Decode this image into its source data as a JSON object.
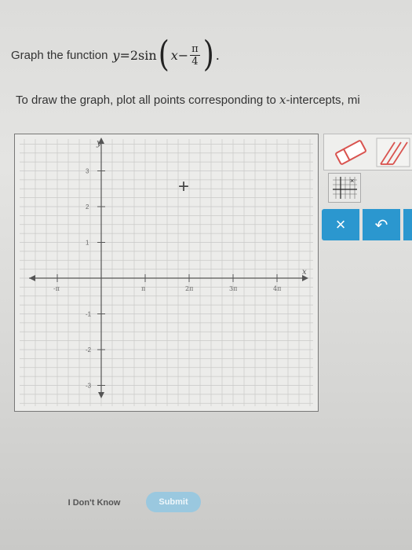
{
  "question": {
    "prefix": "Graph the function",
    "func_y": "y",
    "func_eq": "=2sin",
    "func_x": "x",
    "func_minus": "−",
    "frac_num": "π",
    "frac_den": "4",
    "suffix": "."
  },
  "instruction": {
    "part1": "To draw the graph, plot all points corresponding to ",
    "var": "x",
    "part2": "-intercepts, mi"
  },
  "graph": {
    "y_axis_label": "y",
    "x_axis_label": "x",
    "y_ticks": [
      "3",
      "2",
      "1",
      "-1",
      "-2",
      "-3"
    ],
    "x_ticks": [
      "-π",
      "π",
      "2π",
      "3π",
      "4π"
    ],
    "cursor_glyph": "+"
  },
  "tools": {
    "eraser_icon": "eraser-icon",
    "pencil_icon": "pencil-icon",
    "grid_icon": "grid-point-icon"
  },
  "actions": {
    "clear_label": "×",
    "undo_label": "↶"
  },
  "footer": {
    "dont_know_label": "I Don't Know",
    "submit_label": "Submit"
  },
  "colors": {
    "accent": "#2b97cf",
    "pencil": "#d9534f"
  }
}
